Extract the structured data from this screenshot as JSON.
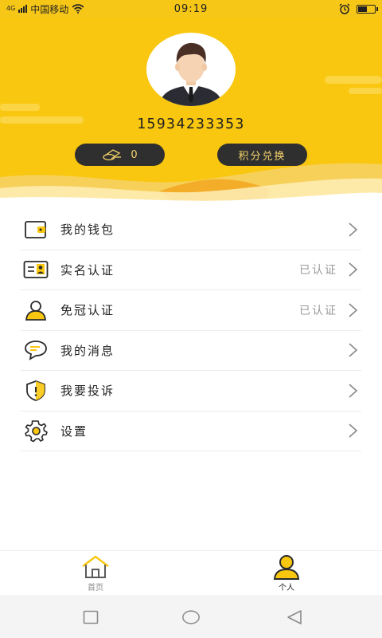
{
  "status_bar": {
    "network": "4G",
    "carrier": "中国移动",
    "time": "09:19"
  },
  "profile": {
    "phone": "15934233353",
    "points_value": "0",
    "exchange_label": "积分兑换"
  },
  "menu": {
    "items": [
      {
        "label": "我的钱包",
        "status": ""
      },
      {
        "label": "实名认证",
        "status": "已认证"
      },
      {
        "label": "免冠认证",
        "status": "已认证"
      },
      {
        "label": "我的消息",
        "status": ""
      },
      {
        "label": "我要投诉",
        "status": ""
      },
      {
        "label": "设置",
        "status": ""
      }
    ]
  },
  "tabbar": {
    "home_label": "首页",
    "me_label": "个人"
  },
  "colors": {
    "brand_yellow": "#f9c70f",
    "pill_dark": "#2f2f2f",
    "status_gray": "#9a9a9a"
  }
}
